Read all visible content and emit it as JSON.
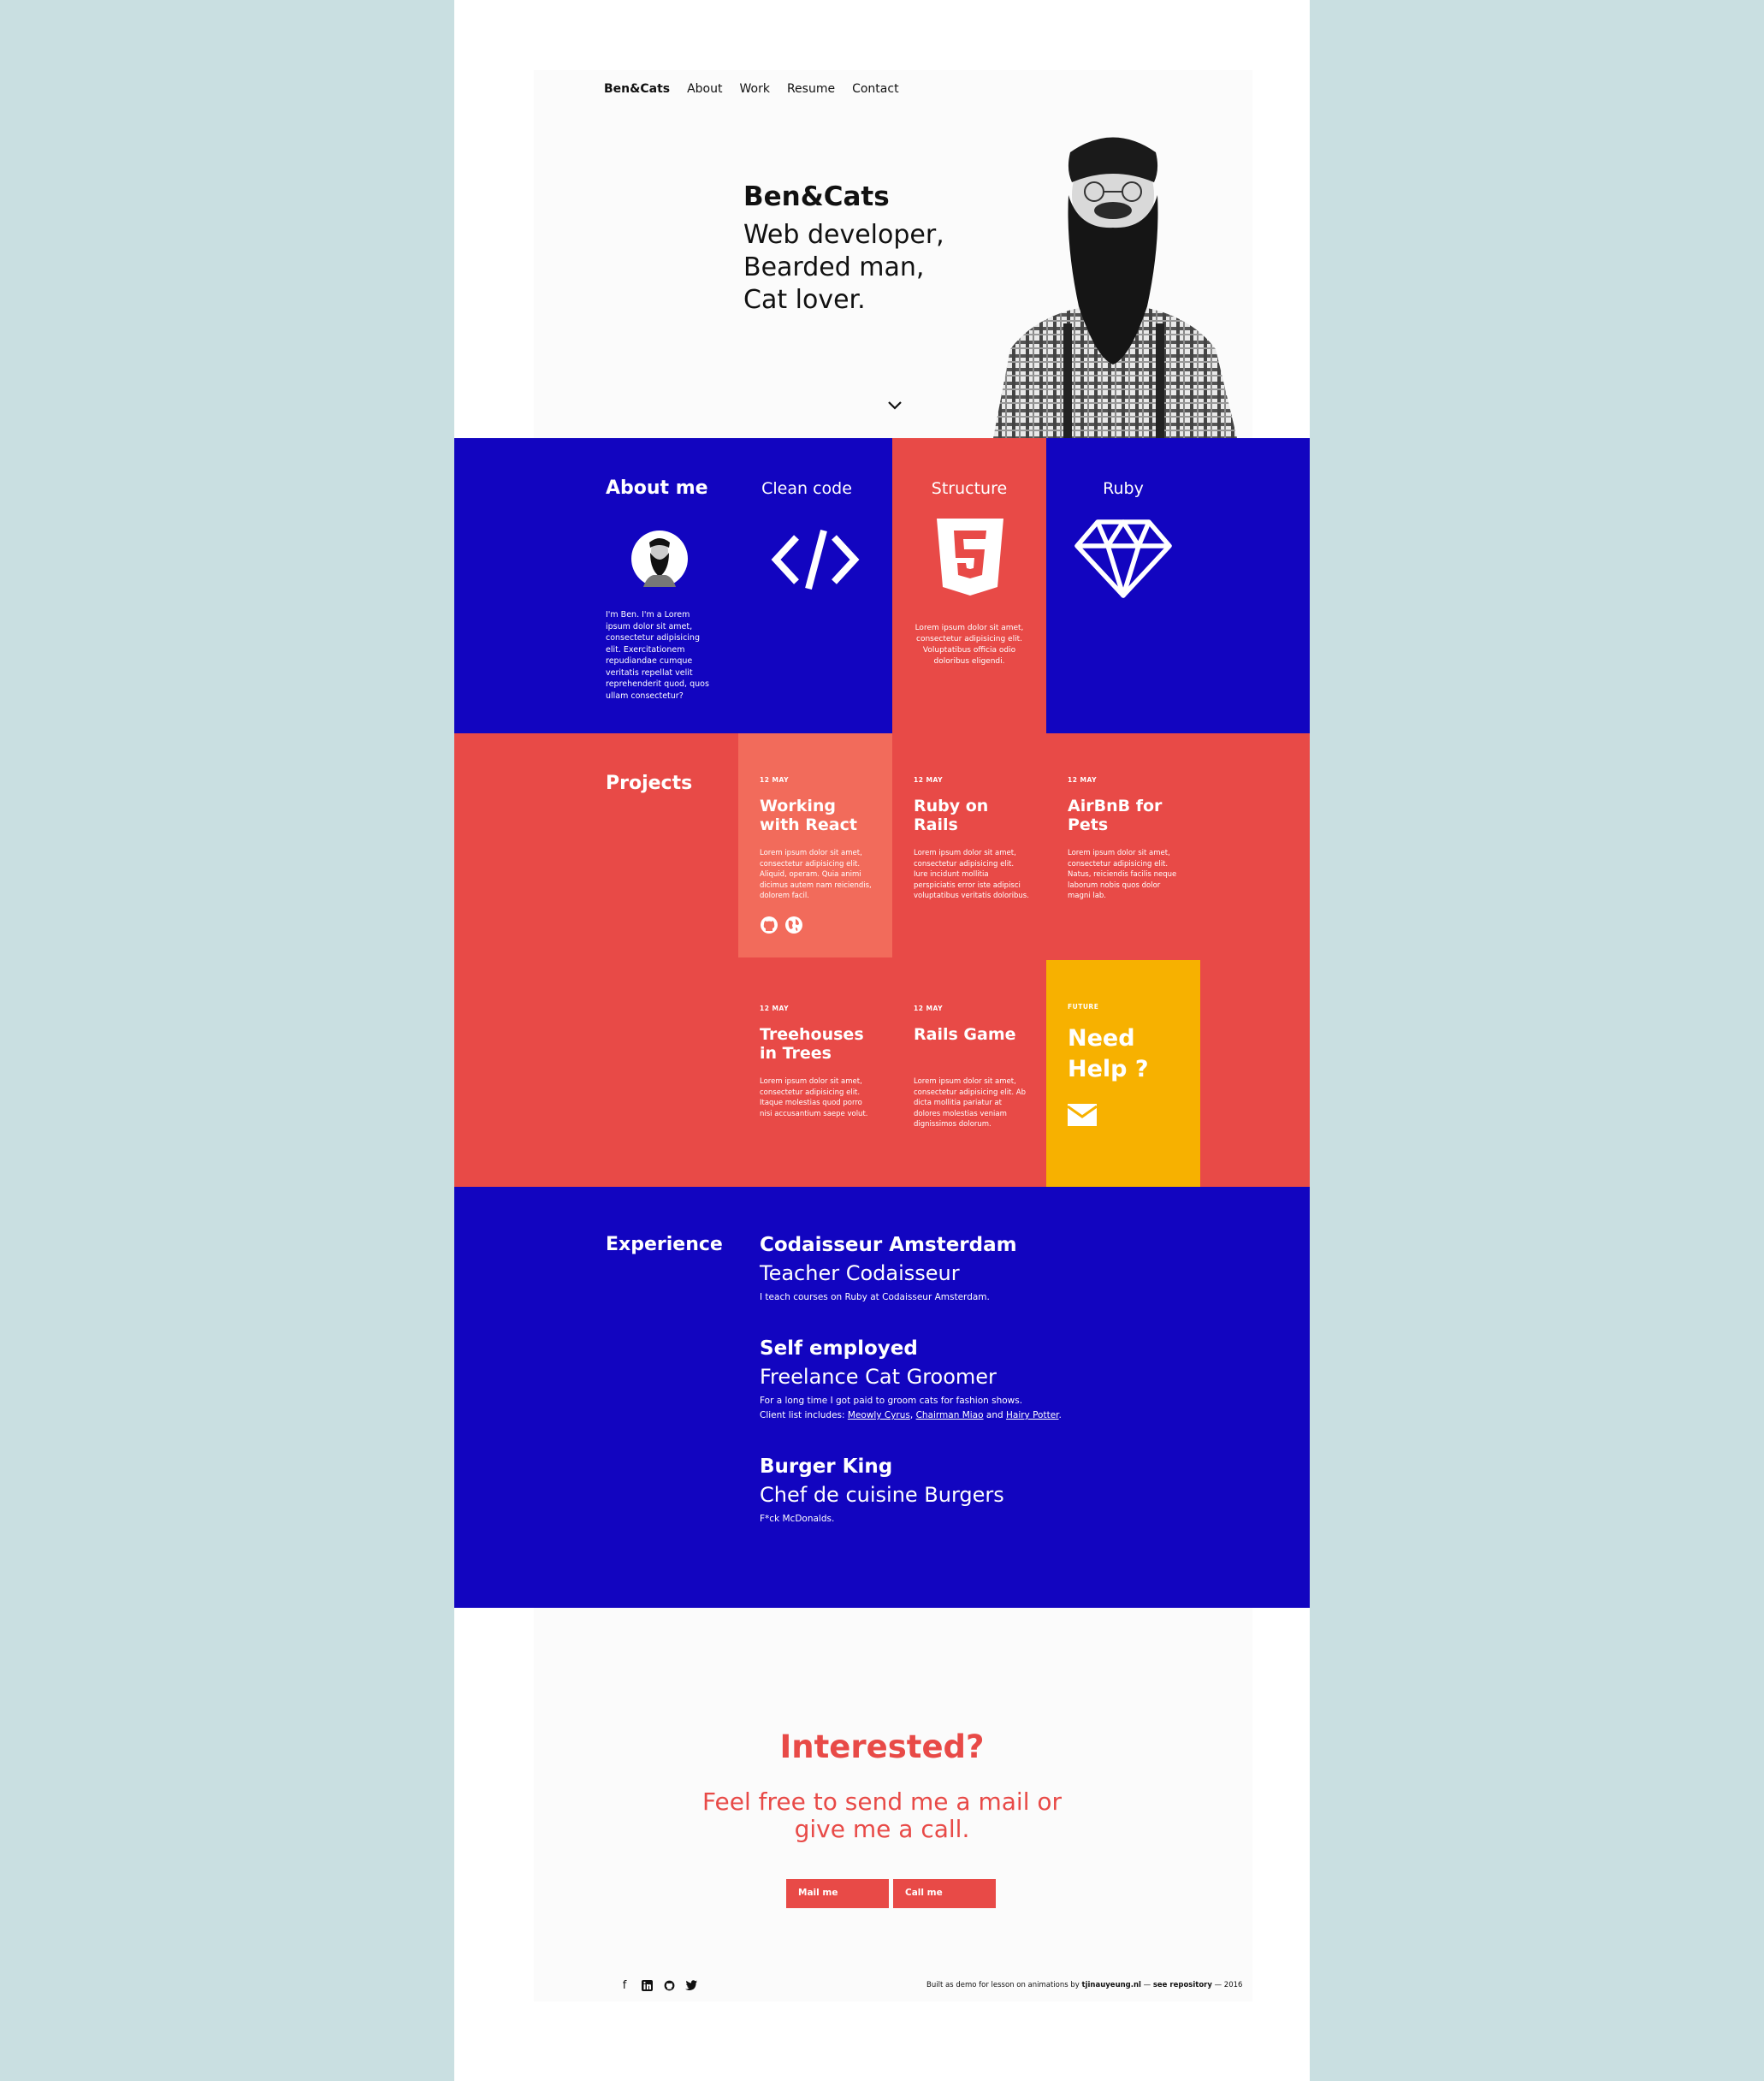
{
  "nav": {
    "brand": "Ben&Cats",
    "items": [
      "About",
      "Work",
      "Resume",
      "Contact"
    ]
  },
  "hero": {
    "name": "Ben&Cats",
    "lines": [
      "Web developer,",
      "Bearded man,",
      "Cat lover."
    ],
    "scroll_icon": "chevron-down-icon"
  },
  "about": {
    "heading": "About me",
    "bio": "I'm Ben. I'm a Lorem ipsum dolor sit amet, consectetur adipisicing elit. Exercitationem repudiandae cumque veritatis repellat velit reprehenderit quod, quos ullam consectetur?",
    "skills": [
      {
        "title": "Clean code",
        "icon": "code-icon",
        "desc": ""
      },
      {
        "title": "Structure",
        "icon": "html5-icon",
        "desc": "Lorem ipsum dolor sit amet, consectetur adipisicing elit. Voluptatibus officia odio doloribus eligendi."
      },
      {
        "title": "Ruby",
        "icon": "diamond-icon",
        "desc": ""
      }
    ]
  },
  "projects": {
    "heading": "Projects",
    "items": [
      {
        "date": "12 MAY",
        "title": "Working with React",
        "desc": "Lorem ipsum dolor sit amet, consectetur adipisicing elit. Aliquid, operam. Quia animi dicimus autem nam reiciendis, dolorem facil."
      },
      {
        "date": "12 MAY",
        "title": "Ruby on Rails",
        "desc": "Lorem ipsum dolor sit amet, consectetur adipisicing elit. Iure incidunt mollitia perspiciatis error iste adipisci voluptatibus veritatis doloribus."
      },
      {
        "date": "12 MAY",
        "title": "AirBnB for Pets",
        "desc": "Lorem ipsum dolor sit amet, consectetur adipisicing elit. Natus, reiciendis facilis neque laborum nobis quos dolor magni lab."
      },
      {
        "date": "12 MAY",
        "title": "Treehouses in Trees",
        "desc": "Lorem ipsum dolor sit amet, consectetur adipisicing elit. Itaque molestias quod porro nisi accusantium saepe volut."
      },
      {
        "date": "12 MAY",
        "title": "Rails Game",
        "desc": "Lorem ipsum dolor sit amet, consectetur adipisicing elit. Ab dicta mollitia pariatur at dolores molestias veniam dignissimos dolorum."
      }
    ],
    "future": {
      "label": "FUTURE",
      "title": "Need Help ?",
      "icon": "envelope-icon"
    },
    "link_icons": [
      "github-icon",
      "globe-icon"
    ]
  },
  "experience": {
    "heading": "Experience",
    "jobs": [
      {
        "company": "Codaisseur Amsterdam",
        "title": "Teacher Codaisseur",
        "desc": "I teach courses on Ruby at Codaisseur Amsterdam."
      },
      {
        "company": "Self employed",
        "title": "Freelance Cat Groomer",
        "desc1": "For a long time I got paid to groom cats for fashion shows.",
        "desc2_prefix": "Client list includes: ",
        "clients": [
          "Meowly Cyrus",
          "Chairman Miao",
          "Hairy Potter"
        ],
        "sep1": ", ",
        "sep2": " and ",
        "end": "."
      },
      {
        "company": "Burger King",
        "title": "Chef de cuisine Burgers",
        "desc": "F*ck McDonalds."
      }
    ]
  },
  "contact": {
    "heading": "Interested?",
    "line1": "Feel free to send me a mail or",
    "line2": "give me a call.",
    "mail_button": "Mail me",
    "call_button": "Call me"
  },
  "footer": {
    "social_icons": [
      "facebook-icon",
      "linkedin-icon",
      "github-icon",
      "twitter-icon"
    ],
    "text_prefix": "Built as demo for lesson on animations by ",
    "author": "tjinauyeung.nl",
    "text_mid": " — ",
    "repo": "see repository",
    "text_suffix": " — 2016"
  },
  "colors": {
    "blue": "#1205c0",
    "red": "#e84a47",
    "salmon": "#f26b5b",
    "yellow": "#f7b100",
    "bg": "#c9dfe1"
  }
}
